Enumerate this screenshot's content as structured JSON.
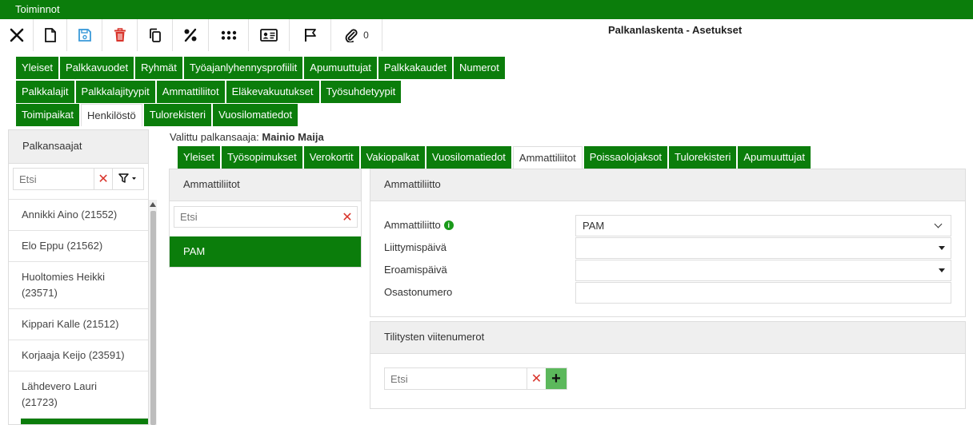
{
  "window": {
    "menu_title": "Toiminnot",
    "page_title": "Palkanlaskenta - Asetukset",
    "attachment_count": "0"
  },
  "toolbar": {
    "icons": [
      "close-icon",
      "new-document-icon",
      "save-icon",
      "delete-icon",
      "copy-icon",
      "percent-icon",
      "grid-dots-icon",
      "id-card-icon",
      "flag-icon",
      "attachment-icon"
    ]
  },
  "main_tabs": {
    "row1": [
      "Yleiset",
      "Palkkavuodet",
      "Ryhmät",
      "Työajanlyhennysprofiilit",
      "Apumuuttujat",
      "Palkkakaudet",
      "Numerot"
    ],
    "row2": [
      "Palkkalajit",
      "Palkkalajityypit",
      "Ammattiliitot",
      "Eläkevakuutukset",
      "Työsuhdetyypit"
    ],
    "row3": [
      "Toimipaikat",
      "Henkilöstö",
      "Tulorekisteri",
      "Vuosilomatiedot"
    ],
    "active": "Henkilöstö"
  },
  "employees_panel": {
    "title": "Palkansaajat",
    "search_placeholder": "Etsi",
    "items": [
      "Annikki Aino (21552)",
      "Elo Eppu (21562)",
      "Huoltomies Heikki (23571)",
      "Kippari Kalle (21512)",
      "Korjaaja Keijo (23591)",
      "Lähdevero Lauri (21723)"
    ]
  },
  "selected_employee": {
    "prefix": "Valittu palkansaaja:",
    "name": "Mainio Maija"
  },
  "employee_tabs": {
    "items": [
      "Yleiset",
      "Työsopimukset",
      "Verokortit",
      "Vakiopalkat",
      "Vuosilomatiedot",
      "Ammattiliitot",
      "Poissaolojaksot",
      "Tulorekisteri",
      "Apumuuttujat"
    ],
    "active": "Ammattiliitot"
  },
  "unions_panel": {
    "title": "Ammattiliitot",
    "search_placeholder": "Etsi",
    "items": [
      "PAM"
    ]
  },
  "union_detail": {
    "title": "Ammattiliitto",
    "union_label": "Ammattiliitto",
    "union_value": "PAM",
    "join_date_label": "Liittymispäivä",
    "join_date_value": "",
    "leave_date_label": "Eroamispäivä",
    "leave_date_value": "",
    "department_label": "Osastonumero",
    "department_value": ""
  },
  "reference_numbers": {
    "title": "Tilitysten viitenumerot",
    "search_placeholder": "Etsi"
  },
  "colors": {
    "brand_green": "#0b7d0b",
    "delete_red": "#d9342b",
    "save_blue": "#3a9ad9",
    "add_green": "#5cb85c"
  }
}
